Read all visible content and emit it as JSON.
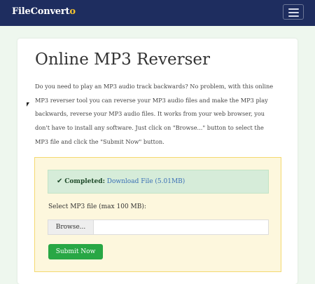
{
  "navbar": {
    "brand_main": "FileConvert",
    "brand_accent": "o",
    "menu_icon": "hamburger-icon"
  },
  "page": {
    "title": "Online MP3 Reverser",
    "description": "Do you need to play an MP3 audio track backwards? No problem, with this online MP3 reverser tool you can reverse your MP3 audio files and make the MP3 play backwards, reverse your MP3 audio files. It works from your web browser, you don't have to install any software. Just click on \"Browse...\" button to select the MP3 file and click the \"Submit Now\" button."
  },
  "upload": {
    "status_icon": "checkmark-icon",
    "status_label": "Completed:",
    "download_link": "Download File (5.01MB)",
    "file_label": "Select MP3 file (max 100 MB):",
    "browse_label": "Browse...",
    "file_value": "",
    "submit_label": "Submit Now"
  },
  "colors": {
    "navbar_bg": "#1e2d5f",
    "brand_accent": "#f2c230",
    "upload_bg": "#fdf7dd",
    "upload_border": "#f4d970",
    "alert_bg": "#d6ecd9",
    "link": "#3a6fb5",
    "submit_bg": "#28a745"
  }
}
